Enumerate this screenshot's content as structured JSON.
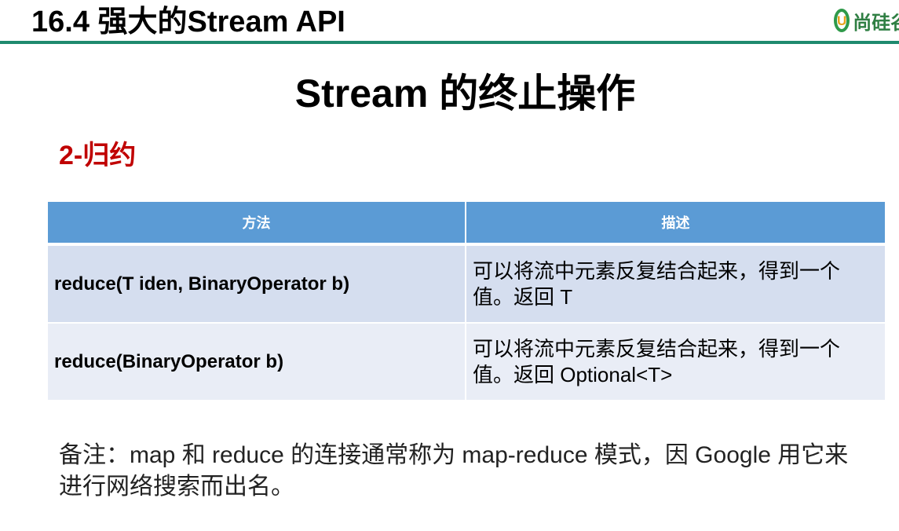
{
  "header": {
    "title": "16.4 强大的Stream API",
    "logo_text": "尚硅谷"
  },
  "slide": {
    "title": "Stream 的终止操作",
    "section": "2-归约"
  },
  "table": {
    "headers": [
      "方法",
      "描述"
    ],
    "rows": [
      {
        "method": "reduce(T iden, BinaryOperator b)",
        "description": "可以将流中元素反复结合起来，得到一个值。返回 T"
      },
      {
        "method": "reduce(BinaryOperator b)",
        "description": "可以将流中元素反复结合起来，得到一个值。返回 Optional<T>"
      }
    ]
  },
  "note": "备注：map 和 reduce 的连接通常称为 map-reduce 模式，因 Google 用它来进行网络搜索而出名。",
  "colors": {
    "header_rule": "#1e8a6e",
    "section_title": "#c00000",
    "table_header_bg": "#5b9bd5",
    "row_bg_1": "#d5deef",
    "row_bg_2": "#e9edf6"
  }
}
